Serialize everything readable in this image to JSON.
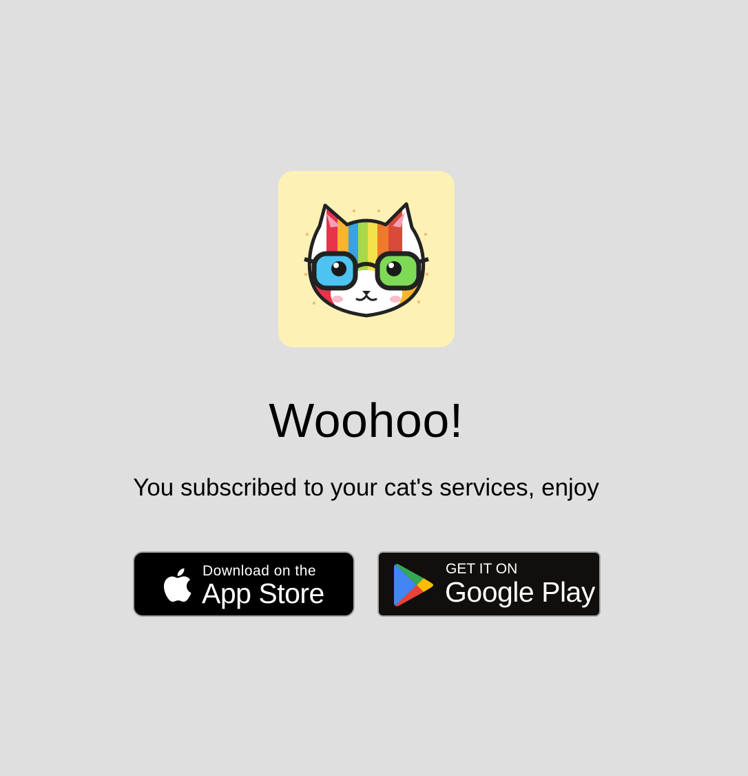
{
  "app_icon": {
    "name": "cat-with-glasses-icon",
    "background": "#fdf1b6"
  },
  "headline": "Woohoo!",
  "subtitle": "You subscribed to your cat's services, enjoy",
  "badges": {
    "app_store": {
      "small_text": "Download on the",
      "big_text": "App Store",
      "icon": "apple-icon"
    },
    "google_play": {
      "small_text": "GET IT ON",
      "big_text": "Google Play",
      "icon": "google-play-icon"
    }
  },
  "colors": {
    "page_background": "#dfdfdf",
    "badge_background": "#000000",
    "badge_border": "#a6a6a6",
    "badge_text": "#ffffff"
  }
}
